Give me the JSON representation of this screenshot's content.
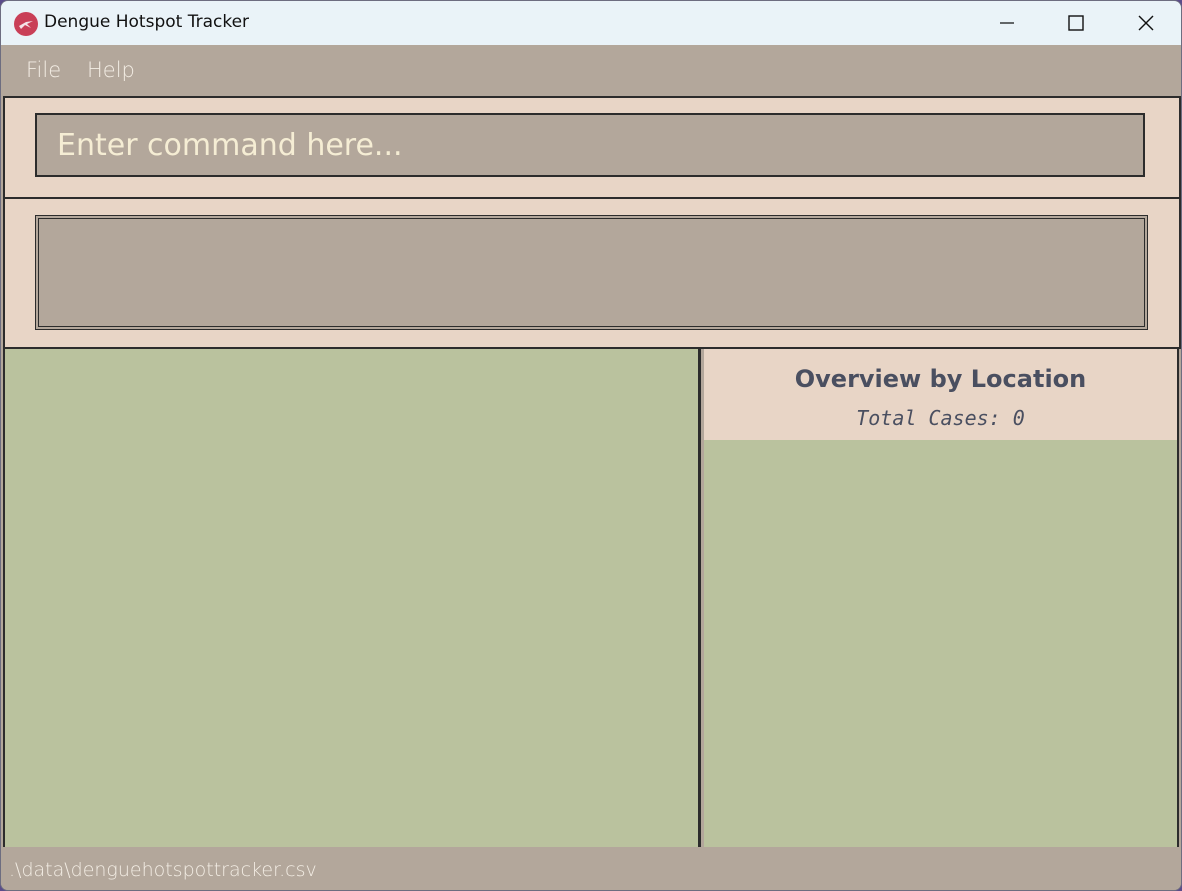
{
  "window": {
    "title": "Dengue Hotspot Tracker",
    "icon": "mosquito-icon",
    "controls": [
      "minimize-icon",
      "maximize-icon",
      "close-icon"
    ]
  },
  "menubar": {
    "items": [
      {
        "label": "File"
      },
      {
        "label": "Help"
      }
    ]
  },
  "command": {
    "placeholder": "Enter command here...",
    "value": ""
  },
  "result": {
    "text": ""
  },
  "overview": {
    "title": "Overview by Location",
    "total_label": "Total Cases:",
    "total_value": "0"
  },
  "status": {
    "file_path": ".\\data\\denguehotspottracker.csv"
  },
  "colors": {
    "panel_bg": "#e8d5c6",
    "input_bg": "#b3a79b",
    "list_bg": "#bac29e",
    "header_text": "#4a4f60",
    "placeholder_text": "#f5edd4"
  }
}
